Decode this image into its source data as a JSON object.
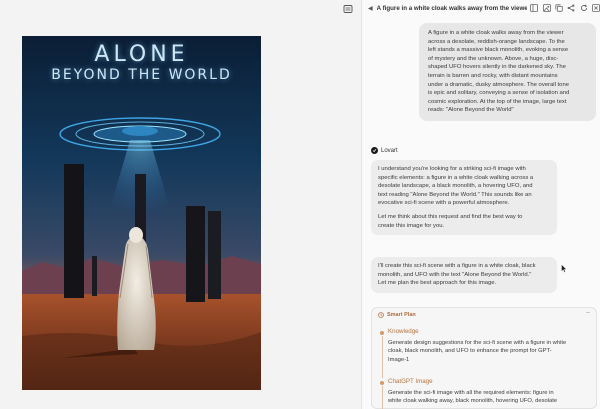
{
  "header": {
    "title": "A figure in a white cloak walks away from the viewer acr..."
  },
  "poster": {
    "title_line1": "ALONE",
    "title_line2": "BEYOND THE WORLD"
  },
  "user_message": {
    "lines": [
      "A figure in a white cloak walks away from the viewer",
      "across a desolate, reddish-orange landscape. To the",
      "left stands a massive black monolith, evoking a sense",
      "of mystery and the unknown. Above, a huge, disc-",
      "shaped UFO hovers silently in the darkened sky. The",
      "terrain is barren and rocky, with distant mountains",
      "under a dramatic, dusky atmosphere. The overall tone",
      "is epic and solitary, conveying a sense of isolation and",
      "cosmic exploration. At the top of the image, large text",
      "reads: \"Alone Beyond the World\""
    ]
  },
  "assistant": {
    "sender_name": "Lovart",
    "message1_lines": [
      "I understand you're looking for a striking sci-fi image with",
      "specific elements: a figure in a white cloak walking across a",
      "desolate landscape, a black monolith, a hovering UFO, and",
      "text reading \"Alone Beyond the World.\" This sounds like an",
      "evocative sci-fi scene with a powerful atmosphere."
    ],
    "message1_para2_lines": [
      "Let me think about this request and find the best way to",
      "create this image for you."
    ],
    "message2_lines": [
      "I'll create this sci-fi scene with a figure in a white cloak, black",
      "monolith, and UFO with the text \"Alone Beyond the World.\"",
      "Let me plan the best approach for this image."
    ]
  },
  "plan": {
    "header_label": "Smart Plan",
    "more_label": "−",
    "steps": [
      {
        "title": "Knowledge",
        "desc_lines": [
          "Generate design suggestions for the sci-fi scene with a figure in white",
          "cloak, black monolith, and UFO to enhance the prompt for GPT-",
          "Image-1"
        ]
      },
      {
        "title": "ChatGPT Image",
        "desc_lines": [
          "Generate the sci-fi image with all the required elements: figure in",
          "white cloak walking away, black monolith, hovering UFO, desolate"
        ]
      }
    ]
  },
  "icons": {
    "header": [
      "hide-panel-icon",
      "image-icon",
      "copy-icon",
      "share-icon",
      "refresh-icon",
      "close-icon"
    ],
    "canvas": "layers-icon"
  },
  "colors": {
    "accent": "#b7743f",
    "user_bubble": "#e7e7e7",
    "assistant_bubble": "#ececec",
    "ufo_glow": "#46b8ff"
  }
}
